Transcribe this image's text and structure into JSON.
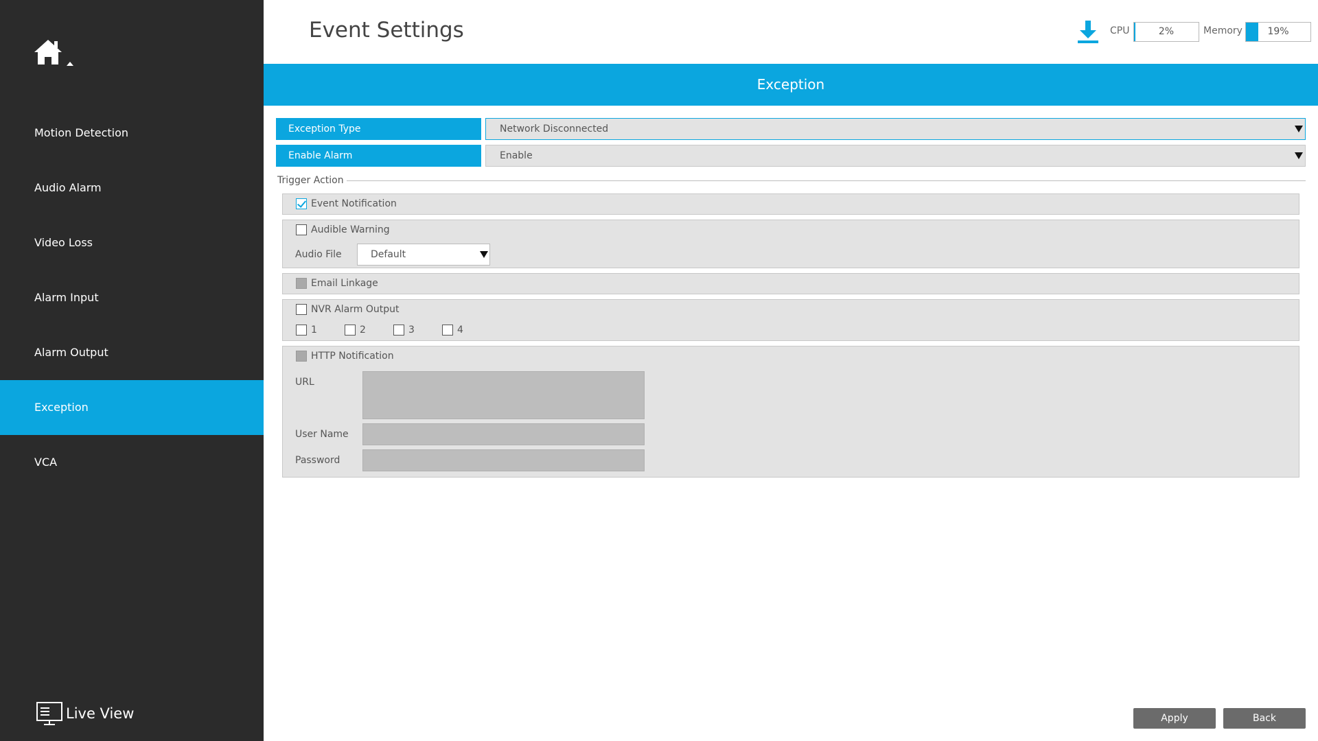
{
  "sidebar": {
    "items": [
      {
        "label": "Motion Detection"
      },
      {
        "label": "Audio Alarm"
      },
      {
        "label": "Video Loss"
      },
      {
        "label": "Alarm Input"
      },
      {
        "label": "Alarm Output"
      },
      {
        "label": "Exception"
      },
      {
        "label": "VCA"
      }
    ],
    "active_index": 5,
    "live_view_label": "Live View"
  },
  "header": {
    "title": "Event Settings",
    "cpu_label": "CPU",
    "cpu_value": "2%",
    "cpu_fraction": 0.02,
    "memory_label": "Memory",
    "memory_value": "19%",
    "memory_fraction": 0.19
  },
  "section": {
    "title": "Exception"
  },
  "form": {
    "exception_type": {
      "label": "Exception Type",
      "value": "Network Disconnected"
    },
    "enable_alarm": {
      "label": "Enable Alarm",
      "value": "Enable"
    }
  },
  "trigger": {
    "legend": "Trigger Action",
    "event_notification": {
      "label": "Event Notification",
      "checked": true
    },
    "audible_warning": {
      "label": "Audible Warning",
      "checked": false,
      "audio_file_label": "Audio File",
      "audio_file_value": "Default"
    },
    "email_linkage": {
      "label": "Email Linkage",
      "checked": false
    },
    "nvr_alarm_output": {
      "label": "NVR Alarm Output",
      "checked": false,
      "outputs": [
        "1",
        "2",
        "3",
        "4"
      ]
    },
    "http_notification": {
      "label": "HTTP Notification",
      "checked": false,
      "url_label": "URL",
      "url_value": "",
      "username_label": "User Name",
      "username_value": "",
      "password_label": "Password",
      "password_value": ""
    }
  },
  "footer": {
    "apply_label": "Apply",
    "back_label": "Back"
  },
  "colors": {
    "accent": "#0ba6df",
    "sidebar_bg": "#2b2b2b",
    "button_bg": "#6b6b6b"
  }
}
